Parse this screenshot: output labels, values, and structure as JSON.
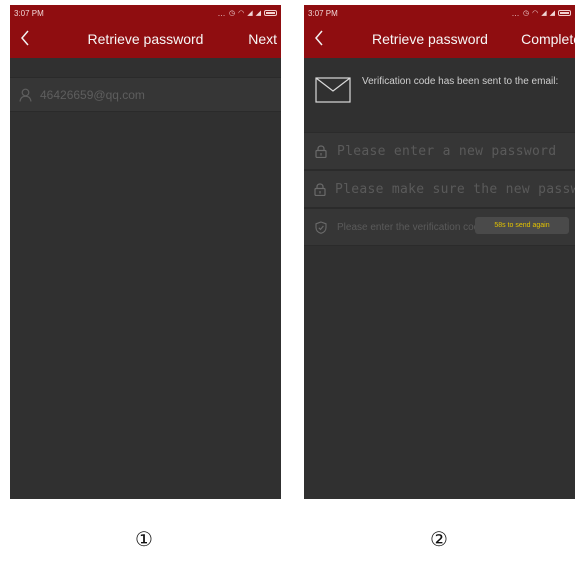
{
  "screens": [
    {
      "status": {
        "time": "3:07 PM"
      },
      "toolbar": {
        "title": "Retrieve password",
        "action": "Next"
      },
      "email": {
        "value": "46426659@qq.com",
        "icon": "person-icon"
      }
    },
    {
      "status": {
        "time": "3:07 PM"
      },
      "toolbar": {
        "title": "Retrieve password",
        "action": "Complete"
      },
      "notice": {
        "text": "Verification code has been sent to the email:",
        "icon": "envelope-icon"
      },
      "fields": {
        "new_password_placeholder": "Please enter a new password",
        "confirm_password_placeholder": "Please make sure the new password",
        "code_placeholder": "Please enter the verification code",
        "send_again_label": "58s to send again"
      }
    }
  ],
  "labels": [
    "①",
    "②"
  ],
  "colors": {
    "toolbar": "#8f0d10",
    "background": "#303030",
    "countdown": "#e3c300"
  }
}
